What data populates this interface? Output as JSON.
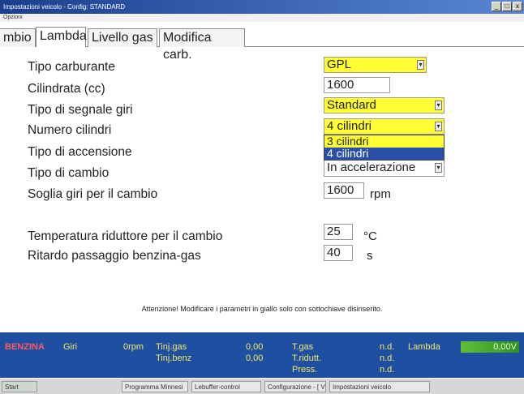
{
  "window": {
    "title": "Impostazioni veicolo - Config: STANDARD",
    "menu": "Opzioni",
    "buttons": [
      "_",
      "□",
      "x"
    ]
  },
  "tabs": [
    {
      "label": "mbio",
      "active": false
    },
    {
      "label": "Lambda",
      "active": true
    },
    {
      "label": "Livello gas",
      "active": false
    },
    {
      "label": "Modifica carb.",
      "active": false
    }
  ],
  "form": {
    "tipo_carburante": {
      "label": "Tipo carburante",
      "value": "GPL"
    },
    "cilindrata": {
      "label": "Cilindrata (cc)",
      "value": "1600"
    },
    "segnale_giri": {
      "label": "Tipo di segnale giri",
      "value": "Standard"
    },
    "numero_cilindri": {
      "label": "Numero cilindri",
      "value": "4 cilindri",
      "options": [
        "3 cilindri",
        "4 cilindri"
      ],
      "selected_option": "4 cilindri"
    },
    "accensione": {
      "label": "Tipo di accensione"
    },
    "cambio": {
      "label": "Tipo di cambio",
      "value": "In accelerazione"
    },
    "soglia_giri": {
      "label": "Soglia giri per il cambio",
      "value": "1600",
      "unit": "rpm"
    },
    "temperatura": {
      "label": "Temperatura riduttore per il cambio",
      "value": "25",
      "unit": "°C"
    },
    "ritardo": {
      "label": "Ritardo passaggio benzina-gas",
      "value": "40",
      "unit": "s"
    }
  },
  "warning": "Attenzione! Modificare i parametri in giallo solo con sottochiave disinserito.",
  "status": {
    "mode": "BENZINA",
    "giri_label": "Giri",
    "giri_value": "0rpm",
    "tinj_gas_label": "Tinj.gas",
    "tinj_gas_value": "0,00",
    "tinj_benz_label": "Tinj.benz",
    "tinj_benz_value": "0,00",
    "tgas_label": "T.gas",
    "tgas_value": "n.d.",
    "tridutt_label": "T.ridutt.",
    "tridutt_value": "n.d.",
    "press_label": "Press.",
    "press_value": "n.d.",
    "lambda_label": "Lambda",
    "lambda_value": "0,00V"
  },
  "taskbar": {
    "items": [
      "Start",
      "Programma Minnesi",
      "Lebuffer-control",
      "Configurazione - [ Vista...",
      "Impostazioni veicolo"
    ]
  },
  "colors": {
    "highlight_field": "#ffff33",
    "status_bg": "#1f4fa0",
    "dropdown_selected": "#2b4fa8",
    "lambda_green": "#3fa52a"
  }
}
